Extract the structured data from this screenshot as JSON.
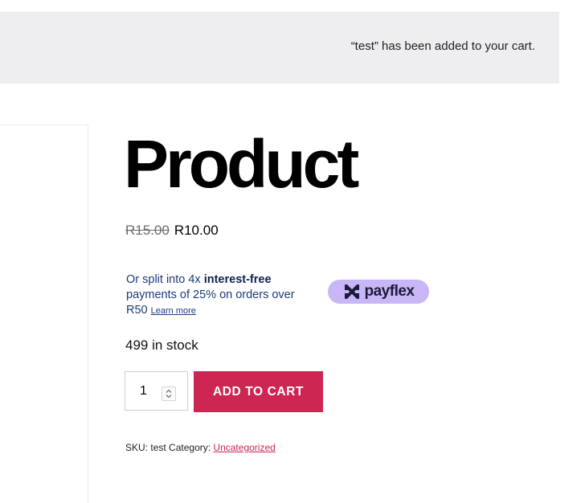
{
  "notice": {
    "message": "“test” has been added to your cart."
  },
  "product": {
    "title": "Product",
    "old_price": "R15.00",
    "price": "R10.00",
    "stock": "499 in stock",
    "quantity": "1",
    "add_to_cart_label": "ADD TO CART"
  },
  "payflex": {
    "line_prefix": "Or split into 4x ",
    "highlight": "interest-free",
    "line_rest": " payments of 25% on orders over R50 ",
    "learn_more": "Learn more",
    "logo_text": "payflex"
  },
  "meta": {
    "sku_label": "SKU:",
    "sku_value": "test",
    "category_label": "Category:",
    "category_value": "Uncategorized"
  },
  "colors": {
    "accent": "#cd2653",
    "payflex_bg": "#c8b6f6",
    "notice_bg": "#eeeef0"
  }
}
